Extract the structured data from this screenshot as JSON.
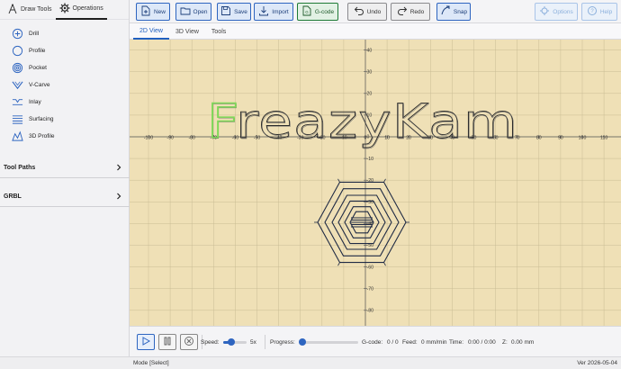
{
  "sidebar": {
    "tabs": [
      {
        "label": "Draw Tools",
        "icon": "compass-icon"
      },
      {
        "label": "Operations",
        "icon": "gear-icon"
      }
    ],
    "operations": [
      {
        "label": "Drill",
        "icon": "drill-icon"
      },
      {
        "label": "Profile",
        "icon": "profile-icon"
      },
      {
        "label": "Pocket",
        "icon": "pocket-icon"
      },
      {
        "label": "V-Carve",
        "icon": "v-carve-icon"
      },
      {
        "label": "Inlay",
        "icon": "inlay-icon"
      },
      {
        "label": "Surfacing",
        "icon": "surfacing-icon"
      },
      {
        "label": "3D Profile",
        "icon": "3d-profile-icon"
      }
    ],
    "sections": [
      {
        "label": "Tool Paths"
      },
      {
        "label": "GRBL"
      }
    ]
  },
  "toolbar": {
    "new_label": "New",
    "open_label": "Open",
    "save_label": "Save",
    "import_label": "Import",
    "gcode_label": "G-code",
    "undo_label": "Undo",
    "redo_label": "Redo",
    "snap_label": "Snap",
    "options_label": "Options",
    "help_label": "Help"
  },
  "view_tabs": [
    "2D View",
    "3D View",
    "Tools"
  ],
  "canvas": {
    "background": "#efe0b6",
    "grid_color": "#c9bc95",
    "axis_color": "#555555",
    "text": "FreazyKam",
    "selected_letter": "F",
    "selected_color": "#7ed957",
    "x_ticks": [
      "-100",
      "-90",
      "-80",
      "-70",
      "-60",
      "-50",
      "-40",
      "-30",
      "-20",
      "-10",
      "0",
      "10",
      "20",
      "30",
      "40",
      "50",
      "60",
      "70",
      "80",
      "90",
      "100",
      "110"
    ],
    "y_ticks": [
      "40",
      "30",
      "20",
      "10",
      "0",
      "-10",
      "-20",
      "-30",
      "-40",
      "-50",
      "-60",
      "-70",
      "-80"
    ]
  },
  "controls": {
    "speed_label": "Speed:",
    "speed_value": "5x",
    "progress_label": "Progress:",
    "gcode_label": "G-code:",
    "gcode_value": "0 / 0",
    "feed_label": "Feed:",
    "feed_value": "0 mm/min",
    "time_label": "Time:",
    "time_value": "0:00 / 0:00",
    "z_label": "Z:",
    "z_value": "0.00 mm",
    "speed_fraction": 0.35,
    "progress_fraction": 0.0
  },
  "status": {
    "mode": "Mode [Select]",
    "version": "Ver 2026-05-04"
  }
}
